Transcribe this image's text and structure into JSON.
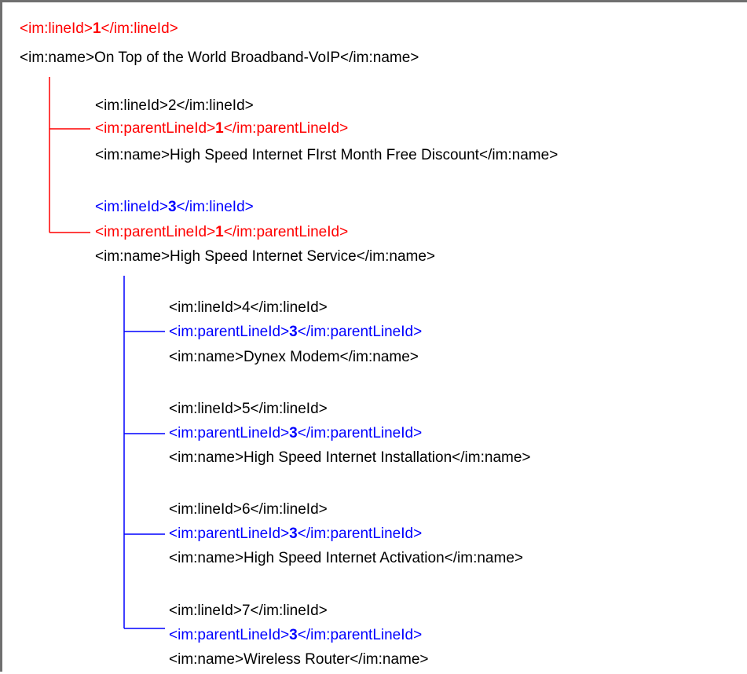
{
  "colors": {
    "root_accent": "#ff0000",
    "child_accent": "#0000ff",
    "default_text": "#000000",
    "frame_border": "#6f6f6f"
  },
  "lines": [
    {
      "open": "<im:lineId>",
      "value": "1",
      "close": "</im:lineId>",
      "color": "#ff0000",
      "value_bold": true
    },
    {
      "open": "<im:name>",
      "value": "On Top of the World Broadband-VoIP",
      "close": "</im:name>",
      "color": "#000000",
      "value_bold": false
    },
    {
      "open": "<im:lineId>",
      "value": "2",
      "close": "</im:lineId>",
      "color": "#000000",
      "value_bold": false
    },
    {
      "open": "<im:parentLineId>",
      "value": "1",
      "close": "</im:parentLineId>",
      "color": "#ff0000",
      "value_bold": true
    },
    {
      "open": "<im:name>",
      "value": "High Speed Internet FIrst Month Free Discount",
      "close": "</im:name>",
      "color": "#000000",
      "value_bold": false
    },
    {
      "open": "<im:lineId>",
      "value": "3",
      "close": "</im:lineId>",
      "color": "#0000ff",
      "value_bold": true
    },
    {
      "open": "<im:parentLineId>",
      "value": "1",
      "close": "</im:parentLineId>",
      "color": "#ff0000",
      "value_bold": true
    },
    {
      "open": "<im:name>",
      "value": "High Speed Internet Service",
      "close": "</im:name>",
      "color": "#000000",
      "value_bold": false
    },
    {
      "open": "<im:lineId>",
      "value": "4",
      "close": "</im:lineId>",
      "color": "#000000",
      "value_bold": false
    },
    {
      "open": "<im:parentLineId>",
      "value": "3",
      "close": "</im:parentLineId>",
      "color": "#0000ff",
      "value_bold": true
    },
    {
      "open": "<im:name>",
      "value": "Dynex Modem",
      "close": "</im:name>",
      "color": "#000000",
      "value_bold": false
    },
    {
      "open": "<im:lineId>",
      "value": "5",
      "close": "</im:lineId>",
      "color": "#000000",
      "value_bold": false
    },
    {
      "open": "<im:parentLineId>",
      "value": "3",
      "close": "</im:parentLineId>",
      "color": "#0000ff",
      "value_bold": true
    },
    {
      "open": "<im:name>",
      "value": "High Speed Internet Installation",
      "close": "</im:name>",
      "color": "#000000",
      "value_bold": false
    },
    {
      "open": "<im:lineId>",
      "value": "6",
      "close": "</im:lineId>",
      "color": "#000000",
      "value_bold": false
    },
    {
      "open": "<im:parentLineId>",
      "value": "3",
      "close": "</im:parentLineId>",
      "color": "#0000ff",
      "value_bold": true
    },
    {
      "open": "<im:name>",
      "value": "High Speed Internet Activation",
      "close": "</im:name>",
      "color": "#000000",
      "value_bold": false
    },
    {
      "open": "<im:lineId>",
      "value": "7",
      "close": "</im:lineId>",
      "color": "#000000",
      "value_bold": false
    },
    {
      "open": "<im:parentLineId>",
      "value": "3",
      "close": "</im:parentLineId>",
      "color": "#0000ff",
      "value_bold": true
    },
    {
      "open": "<im:name>",
      "value": "Wireless Router",
      "close": "</im:name>",
      "color": "#000000",
      "value_bold": false
    }
  ]
}
